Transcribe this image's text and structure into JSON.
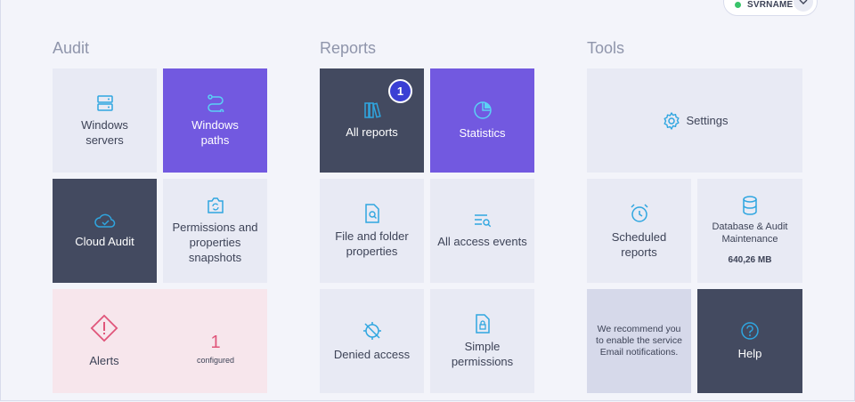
{
  "server": {
    "name": "SVRNAME",
    "status_color": "#39c46a"
  },
  "sections": {
    "audit": "Audit",
    "reports": "Reports",
    "tools": "Tools"
  },
  "audit": {
    "windows_servers": "Windows servers",
    "windows_paths": "Windows paths",
    "cloud_audit": "Cloud Audit",
    "permissions_snapshots": "Permissions and properties snapshots",
    "alerts": {
      "label": "Alerts",
      "count": "1",
      "count_label": "configured"
    }
  },
  "reports": {
    "all_reports": "All reports",
    "all_reports_badge": "1",
    "statistics": "Statistics",
    "file_folder_properties": "File and folder properties",
    "all_access_events": "All access events",
    "denied_access": "Denied access",
    "simple_permissions": "Simple permissions"
  },
  "tools": {
    "settings": "Settings",
    "scheduled_reports": "Scheduled reports",
    "database_maintenance": "Database & Audit Maintenance",
    "database_size": "640,26 MB",
    "recommendation": "We recommend you to enable the service Email notifications.",
    "help": "Help"
  },
  "colors": {
    "accent": "#2fa6e0",
    "purple": "#7259e0",
    "dark": "#434a60",
    "alert": "#e0557a"
  }
}
